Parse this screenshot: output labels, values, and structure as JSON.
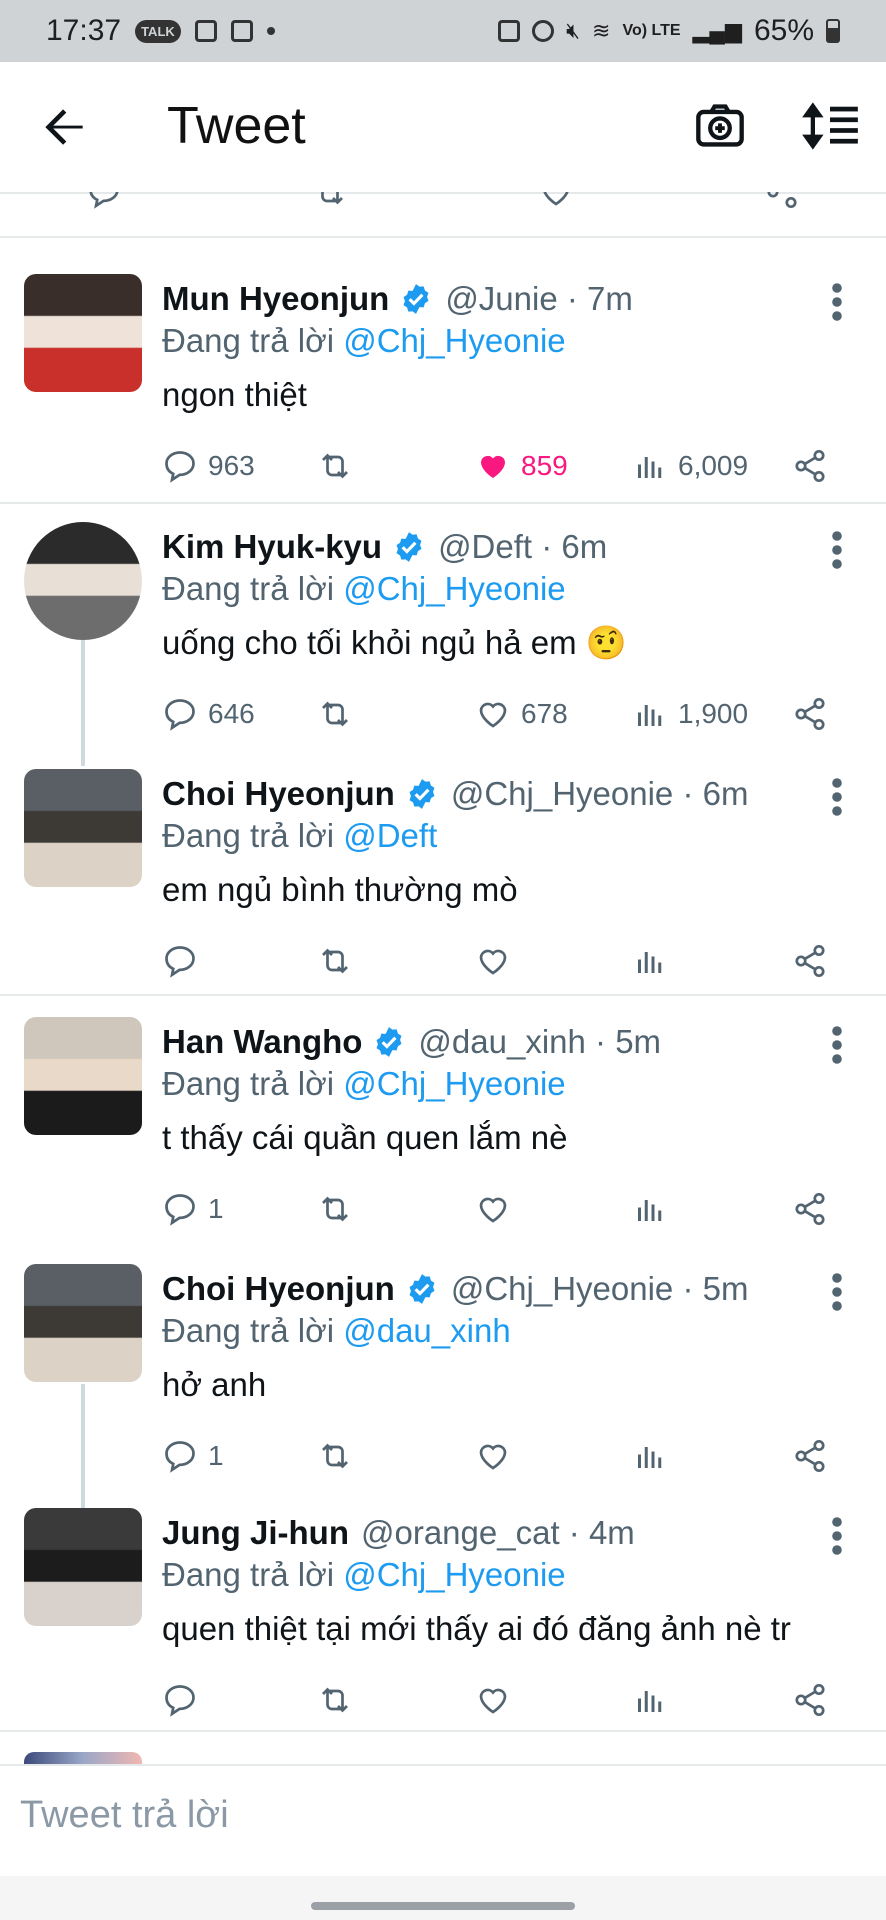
{
  "status_bar": {
    "time": "17:37",
    "talk_badge": "TALK",
    "network": "Vo) LTE",
    "battery": "65%"
  },
  "header": {
    "title": "Tweet"
  },
  "tweets": [
    {
      "name": "Mun Hyeonjun",
      "verified": true,
      "handle": "@Junie · 7m",
      "reply_prefix": "Đang trả lời",
      "reply_to": "@Chj_Hyeonie",
      "text": "ngon thiệt",
      "replies": "963",
      "retweets": "",
      "likes": "859",
      "liked": true,
      "views": "6,009"
    },
    {
      "name": "Kim Hyuk-kyu",
      "verified": true,
      "handle": "@Deft · 6m",
      "reply_prefix": "Đang trả lời",
      "reply_to": "@Chj_Hyeonie",
      "text": "uống cho tối khỏi ngủ hả em",
      "emoji": "🤨",
      "replies": "646",
      "retweets": "",
      "likes": "678",
      "liked": false,
      "views": "1,900"
    },
    {
      "name": "Choi Hyeonjun",
      "verified": true,
      "handle": "@Chj_Hyeonie · 6m",
      "reply_prefix": "Đang trả lời",
      "reply_to": "@Deft",
      "text": "em ngủ bình thường mò",
      "replies": "",
      "retweets": "",
      "likes": "",
      "liked": false,
      "views": ""
    },
    {
      "name": "Han Wangho",
      "verified": true,
      "handle": "@dau_xinh · 5m",
      "reply_prefix": "Đang trả lời",
      "reply_to": "@Chj_Hyeonie",
      "text": "t thấy cái quần quen lắm nè",
      "replies": "1",
      "retweets": "",
      "likes": "",
      "liked": false,
      "views": ""
    },
    {
      "name": "Choi Hyeonjun",
      "verified": true,
      "handle": "@Chj_Hyeonie · 5m",
      "reply_prefix": "Đang trả lời",
      "reply_to": "@dau_xinh",
      "text": "hở anh",
      "replies": "1",
      "retweets": "",
      "likes": "",
      "liked": false,
      "views": ""
    },
    {
      "name": "Jung Ji-hun",
      "verified": false,
      "handle": "@orange_cat · 4m",
      "reply_prefix": "Đang trả lời",
      "reply_to": "@Chj_Hyeonie",
      "text": "quen thiệt tại mới thấy ai đó đăng ảnh nè tr",
      "replies": "",
      "retweets": "",
      "likes": "",
      "liked": false,
      "views": ""
    }
  ],
  "composer": {
    "placeholder": "Tweet trả lời"
  },
  "colors": {
    "accent": "#1d9bf0",
    "like": "#f91880",
    "muted": "#536471"
  }
}
